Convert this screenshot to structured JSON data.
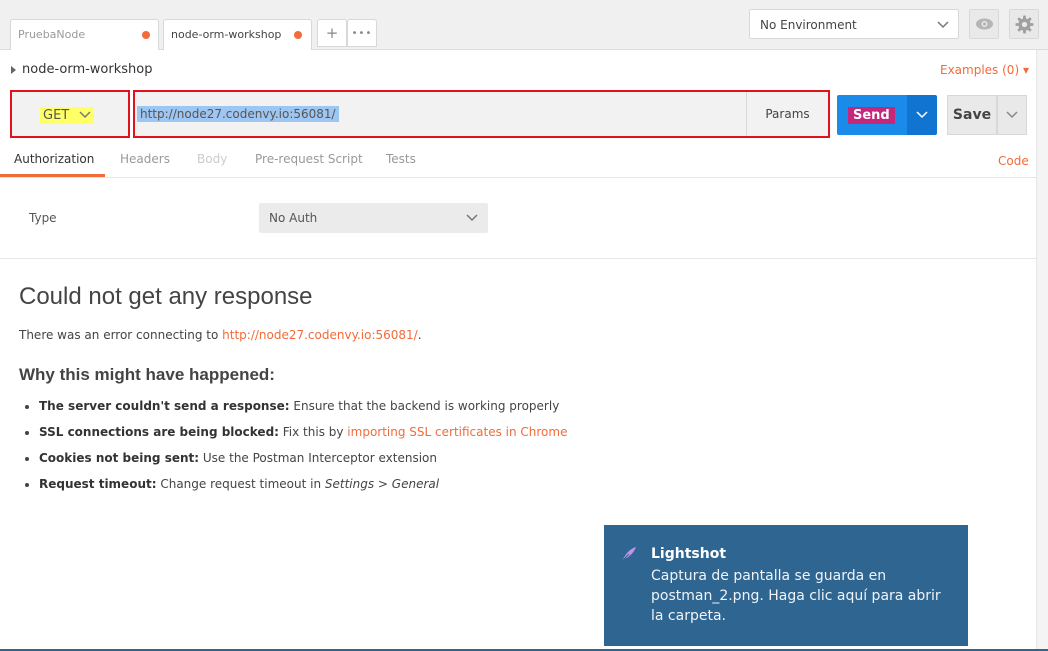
{
  "tabs": [
    {
      "label": "PruebaNode",
      "unsaved": true
    },
    {
      "label": "node-orm-workshop",
      "unsaved": true,
      "active": true
    }
  ],
  "tabbar": {
    "new_tab": "+",
    "more": "•••"
  },
  "environment": {
    "selected": "No Environment"
  },
  "request": {
    "name": "node-orm-workshop",
    "examples": "Examples (0) ▾",
    "method": "GET",
    "url": "http://node27.codenvy.io:56081/",
    "params_label": "Params",
    "send_label": "Send",
    "save_label": "Save"
  },
  "request_tabs": [
    {
      "label": "Authorization",
      "active": true
    },
    {
      "label": "Headers"
    },
    {
      "label": "Body"
    },
    {
      "label": "Pre-request Script"
    },
    {
      "label": "Tests"
    }
  ],
  "code_label": "Code",
  "auth": {
    "type_label": "Type",
    "type_value": "No Auth"
  },
  "response": {
    "title": "Could not get any response",
    "error_prefix": "There was an error connecting to ",
    "error_link": "http://node27.codenvy.io:56081/",
    "error_suffix": ".",
    "why_title": "Why this might have happened:",
    "reasons": [
      {
        "bold": "The server couldn't send a response:",
        "text": " Ensure that the backend is working properly"
      },
      {
        "bold": "SSL connections are being blocked:",
        "text": " Fix this by ",
        "link": "importing SSL certificates in Chrome"
      },
      {
        "bold": "Cookies not being sent:",
        "text": " Use the Postman Interceptor extension"
      },
      {
        "bold": "Request timeout:",
        "text": " Change request timeout in ",
        "italic": "Settings > General"
      }
    ]
  },
  "toast": {
    "title": "Lightshot",
    "body": "Captura de pantalla se guarda en postman_2.png. Haga clic aquí para abrir la carpeta."
  },
  "colors": {
    "accent": "#f26b3a",
    "send": "#1b8bea",
    "highlight": "#e0121e",
    "toast": "#2f6591"
  }
}
